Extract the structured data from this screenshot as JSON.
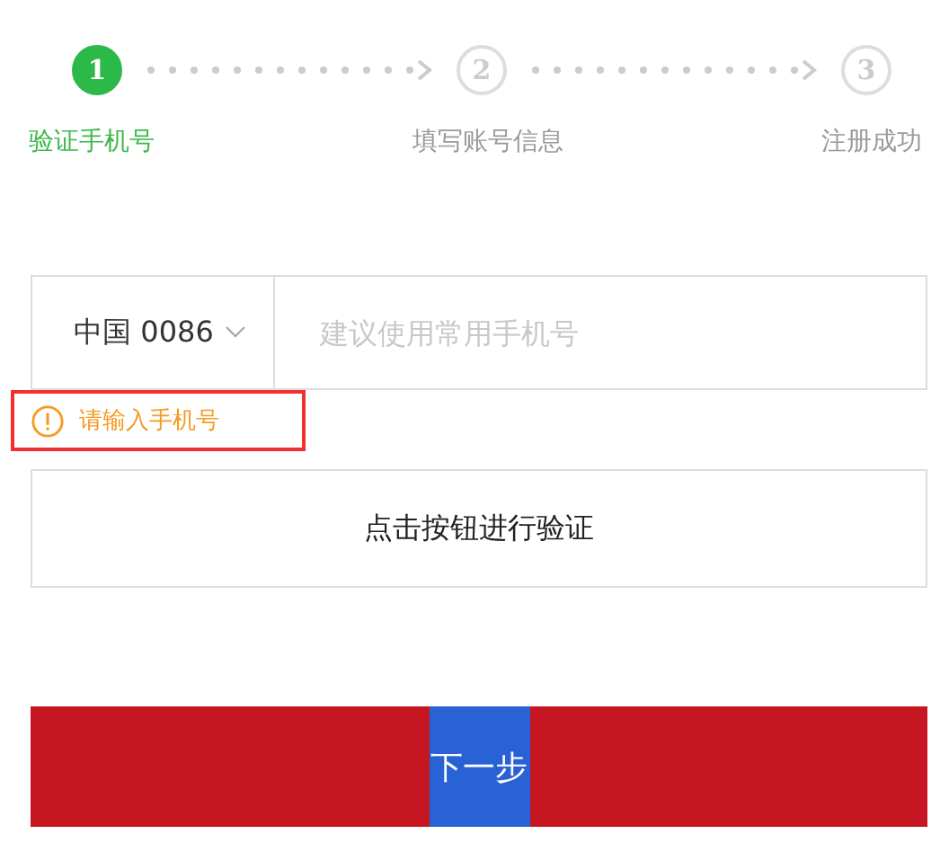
{
  "steps": [
    {
      "number": "1",
      "label": "验证手机号",
      "selected": true
    },
    {
      "number": "2",
      "label": "填写账号信息",
      "selected": false
    },
    {
      "number": "3",
      "label": "注册成功",
      "selected": false
    }
  ],
  "phone": {
    "country": "中国 0086",
    "placeholder": "建议使用常用手机号"
  },
  "error": {
    "text": "请输入手机号"
  },
  "verify_button": {
    "label": "点击按钮进行验证"
  },
  "next_button": {
    "label": "下一步"
  }
}
